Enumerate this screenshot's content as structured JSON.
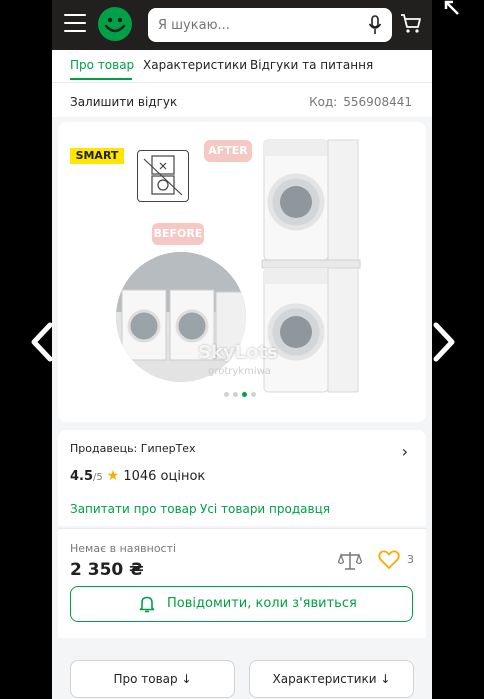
{
  "header": {
    "search_placeholder": "Я шукаю...",
    "icons": [
      "menu-icon",
      "logo-icon",
      "microphone-icon",
      "cart-icon"
    ],
    "colors": {
      "header_bg": "#221f1f",
      "accent": "#00a046"
    }
  },
  "tabs": [
    {
      "label": "Про товар",
      "active": true
    },
    {
      "label": "Характеристики",
      "active": false
    },
    {
      "label": "Відгуки та питання",
      "active": false
    }
  ],
  "review": {
    "leave_review": "Залишити відгук",
    "code_label": "Код:",
    "code_value": "556908441"
  },
  "gallery": {
    "smart_badge": "SMART",
    "after_label": "AFTER",
    "before_label": "BEFORE",
    "watermark": "SkyLots",
    "watermark_sub": "grotrykmiwa",
    "slide_count": 4,
    "active_slide": 2
  },
  "seller": {
    "label": "Продавець:",
    "name": "ГиперТех",
    "rating": "4.5",
    "rating_max": "/5",
    "reviews": "1046 оцінок",
    "ask_link": "Запитати про товар",
    "all_products_link": "Усі товари продавця"
  },
  "price_block": {
    "stock_status": "Немає в наявності",
    "price": "2 350 ₴",
    "favorites_count": "3",
    "notify_button": "Повідомити, коли з'явиться"
  },
  "bottom_buttons": {
    "about": "Про товар ↓",
    "specs": "Характеристики ↓"
  }
}
